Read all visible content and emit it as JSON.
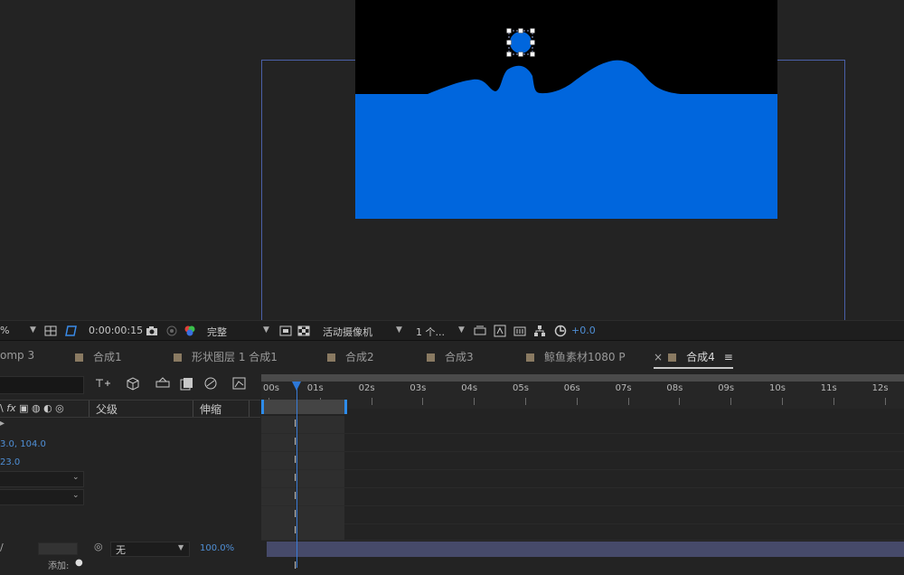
{
  "toolbar": {
    "zoom_suffix": "%",
    "timecode": "0:00:00:15",
    "resolution": "完整",
    "view": "活动摄像机",
    "views_count": "1 个...",
    "exposure": "+0.0"
  },
  "tabs": [
    {
      "label": "omp 3"
    },
    {
      "label": "合成1"
    },
    {
      "label": "形状图层 1 合成1"
    },
    {
      "label": "合成2"
    },
    {
      "label": "合成3"
    },
    {
      "label": "鲸鱼素材1080 P"
    },
    {
      "label": "合成4",
      "active": true
    }
  ],
  "left_panel": {
    "columns": {
      "parent": "父级",
      "stretch": "伸缩"
    },
    "values": {
      "position": "3.0, 104.0",
      "rotation": "23.0"
    },
    "parent_value": "无",
    "stretch_value": "100.0%",
    "add_label": "添加:"
  },
  "ruler": {
    "labels": [
      "00s",
      "01s",
      "02s",
      "03s",
      "04s",
      "05s",
      "06s",
      "07s",
      "08s",
      "09s",
      "10s",
      "11s",
      "12s"
    ]
  },
  "colors": {
    "accent": "#2d78d8",
    "comp_blue": "#0066dd",
    "swatch": "#8a7a62",
    "layer_bar": "#464a6a"
  },
  "icons": [
    "camera-icon",
    "color-channel-icon",
    "grid-icon",
    "region-icon",
    "toggle-icon",
    "reset-exposure-icon",
    "graph-editor-icon"
  ]
}
